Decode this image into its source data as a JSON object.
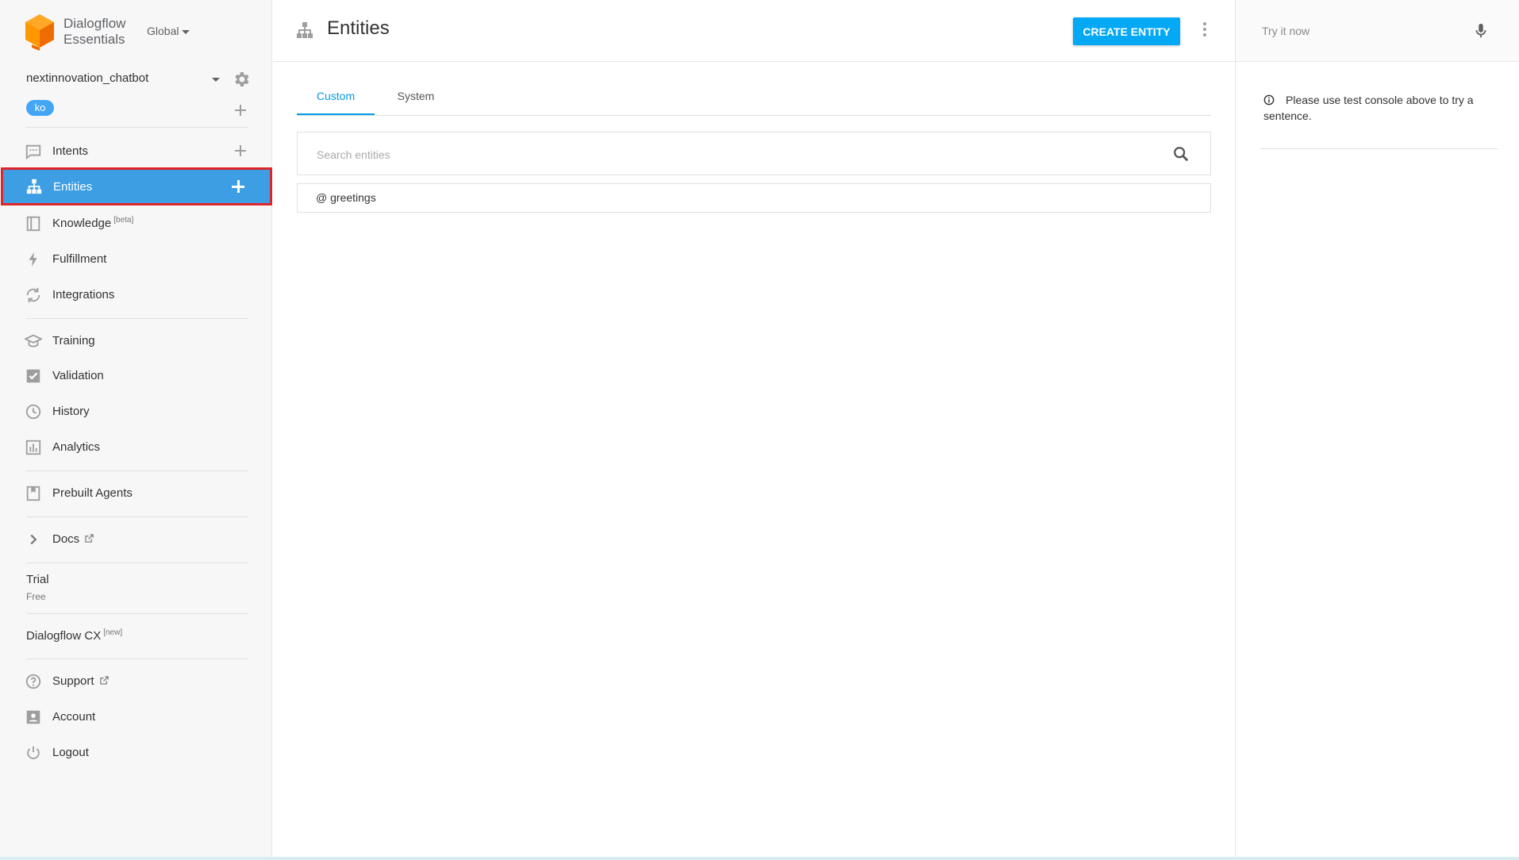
{
  "brand": {
    "line1": "Dialogflow",
    "line2": "Essentials",
    "region": "Global"
  },
  "agent": {
    "name": "nextinnovation_chatbot",
    "language": "ko"
  },
  "sidebar": {
    "items": [
      {
        "label": "Intents",
        "icon": "chat-icon"
      },
      {
        "label": "Entities",
        "icon": "hierarchy-icon",
        "active": true
      },
      {
        "label": "Knowledge",
        "sup": "[beta]",
        "icon": "book-icon"
      },
      {
        "label": "Fulfillment",
        "icon": "bolt-icon"
      },
      {
        "label": "Integrations",
        "icon": "sync-icon"
      },
      {
        "label": "Training",
        "icon": "graduation-cap-icon"
      },
      {
        "label": "Validation",
        "icon": "checkbox-icon"
      },
      {
        "label": "History",
        "icon": "clock-icon"
      },
      {
        "label": "Analytics",
        "icon": "bar-chart-icon"
      },
      {
        "label": "Prebuilt Agents",
        "icon": "bookmark-icon"
      },
      {
        "label": "Docs",
        "icon": "chevron-right-icon"
      },
      {
        "label": "Support",
        "icon": "help-circle-icon"
      },
      {
        "label": "Account",
        "icon": "account-box-icon"
      },
      {
        "label": "Logout",
        "icon": "power-icon"
      }
    ],
    "trial": {
      "title": "Trial",
      "subtitle": "Free"
    },
    "cx": {
      "label": "Dialogflow CX",
      "sup": "[new]"
    }
  },
  "header": {
    "title": "Entities",
    "create_label": "CREATE ENTITY"
  },
  "tabs": [
    {
      "label": "Custom",
      "active": true
    },
    {
      "label": "System"
    }
  ],
  "search": {
    "placeholder": "Search entities"
  },
  "entities": [
    {
      "label": "@ greetings"
    }
  ],
  "test_console": {
    "placeholder": "Try it now",
    "message": "Please use test console above to try a sentence."
  },
  "colors": {
    "accent": "#039be5",
    "active_bg": "#3d9ee4",
    "highlight": "#e0242b",
    "button": "#03a9f4"
  }
}
